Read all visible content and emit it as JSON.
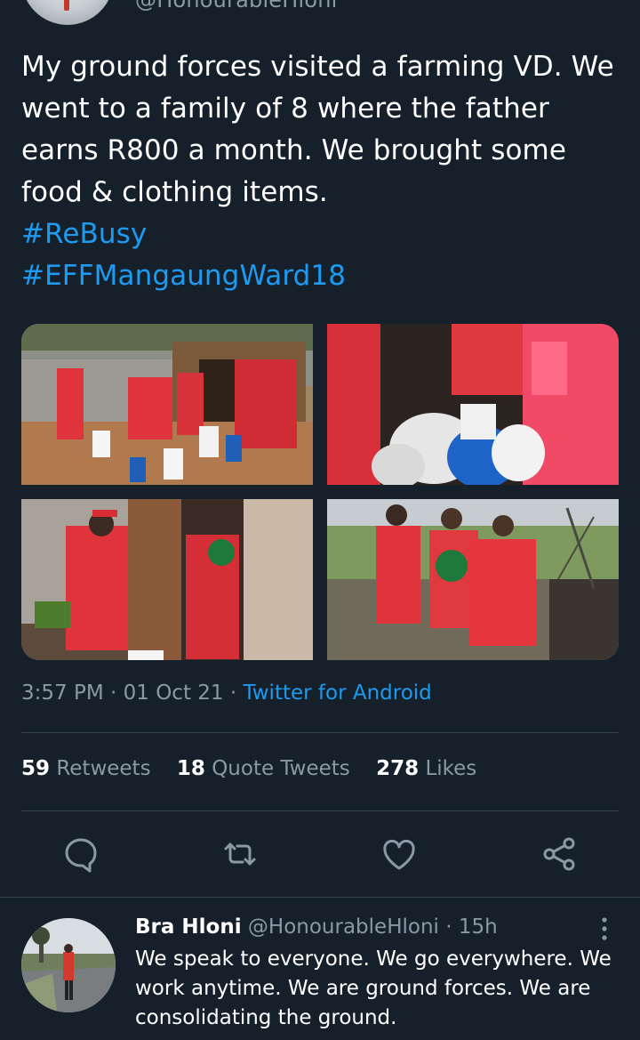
{
  "top": {
    "handle": "@HonourableHloni"
  },
  "tweet": {
    "text": "My ground forces visited a farming VD. We went to a family of 8 where the father earns R800 a month. We brought some food & clothing items.",
    "hashtags": [
      "#ReBusy",
      "#EFFMangaungWard18"
    ],
    "media": [
      {
        "icon": "photo-family-outside-shack"
      },
      {
        "icon": "photo-food-bags"
      },
      {
        "icon": "photo-member-at-door"
      },
      {
        "icon": "photo-three-members-field"
      }
    ],
    "time": "3:57 PM",
    "date": "01 Oct 21",
    "source": "Twitter for Android",
    "separator": "·",
    "stats": {
      "retweets_count": "59",
      "retweets_label": "Retweets",
      "quotes_count": "18",
      "quotes_label": "Quote Tweets",
      "likes_count": "278",
      "likes_label": "Likes"
    },
    "actions": [
      {
        "icon": "reply-icon"
      },
      {
        "icon": "retweet-icon"
      },
      {
        "icon": "like-icon"
      },
      {
        "icon": "share-icon"
      }
    ]
  },
  "reply": {
    "name": "Bra Hloni",
    "handle": "@HonourableHloni",
    "time": "· 15h",
    "text": "We speak to everyone. We go everywhere. We work anytime. We are ground forces. We are consolidating the ground."
  },
  "colors": {
    "background": "#15202b",
    "accent": "#1d9bf0",
    "secondary_text": "#8b98a5",
    "divider": "#38444d"
  }
}
